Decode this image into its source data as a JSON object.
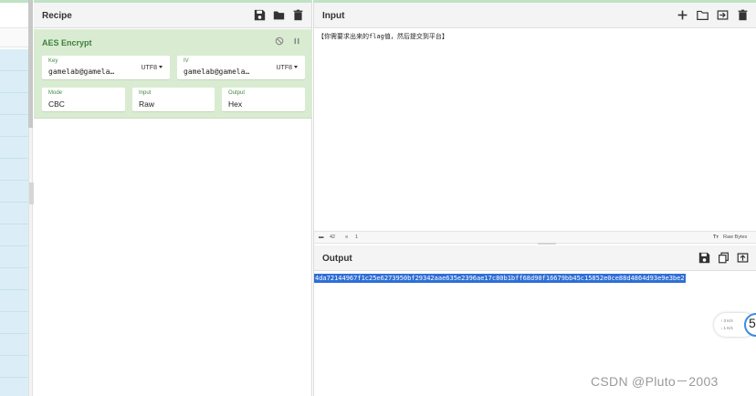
{
  "recipe": {
    "title": "Recipe",
    "operation": {
      "name": "AES Encrypt",
      "key": {
        "label": "Key",
        "value": "gamelab@gamela…",
        "encoding": "UTF8"
      },
      "iv": {
        "label": "IV",
        "value": "gamelab@gamela…",
        "encoding": "UTF8"
      },
      "mode": {
        "label": "Mode",
        "value": "CBC"
      },
      "input": {
        "label": "Input",
        "value": "Raw"
      },
      "output": {
        "label": "Output",
        "value": "Hex"
      }
    }
  },
  "input": {
    "title": "Input",
    "text": "【你需要求出来的flag值，然后提交到平台】",
    "status": {
      "length": "42",
      "lines": "1",
      "mode": "Raw Bytes"
    }
  },
  "output": {
    "title": "Output",
    "text": "4da72144967f1c25e6273950bf29342aae635e2396ae17c80b1bff68d90f16679bb45c15852e0ce88d4864d93e9e3be2"
  },
  "speed": {
    "up": "3",
    "down": "1",
    "unit": "K/s",
    "badge": "5"
  },
  "watermark": "CSDN @Pluto－2003",
  "colors": {
    "operation_bg": "#d9ecd1",
    "operation_text": "#3f7f3f",
    "selection": "#2f6fd6"
  }
}
